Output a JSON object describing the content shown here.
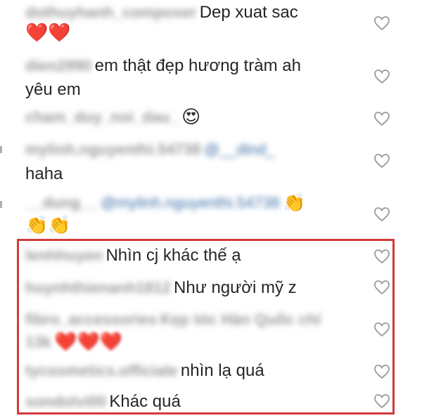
{
  "comments": [
    {
      "username": "dothuyhanh_composer",
      "text": "Dep xuat sac",
      "emoji_line": "❤️❤️"
    },
    {
      "username": "dien2990",
      "text": "em thật đẹp hương tràm ah",
      "text_line2": "yêu em"
    },
    {
      "username": "cham_duy_noi_dau_",
      "text": "",
      "emoji_line": "😍"
    },
    {
      "username": "mylinh.nguyenthi.54738",
      "mention": "@__dind_",
      "text": "",
      "text_line2": "haha"
    },
    {
      "username": "__dung__",
      "mention": "@mylinh.nguyenthi.54738",
      "emoji_line": "👏",
      "emoji_line2": "👏👏"
    },
    {
      "username": "lenhhuyen",
      "text": "Nhìn cj khác thế ạ"
    },
    {
      "username": "huynhthienanh1812",
      "text": "Như người mỹ z"
    },
    {
      "username": "fibro_accessories",
      "text": "Kẹp tóc Hàn Quốc chỉ",
      "text_line2": "13k",
      "emoji_line": "❤️❤️❤️"
    },
    {
      "username": "tycosmetics.officiale",
      "text": "nhìn lạ quá"
    },
    {
      "username": "sondolvi00",
      "text": "Khác quá"
    }
  ],
  "icons": {
    "like": "heart-outline-icon"
  },
  "colors": {
    "highlight": "#d33a3a",
    "mention": "#3b6fa8",
    "heart": "#e0202a"
  }
}
